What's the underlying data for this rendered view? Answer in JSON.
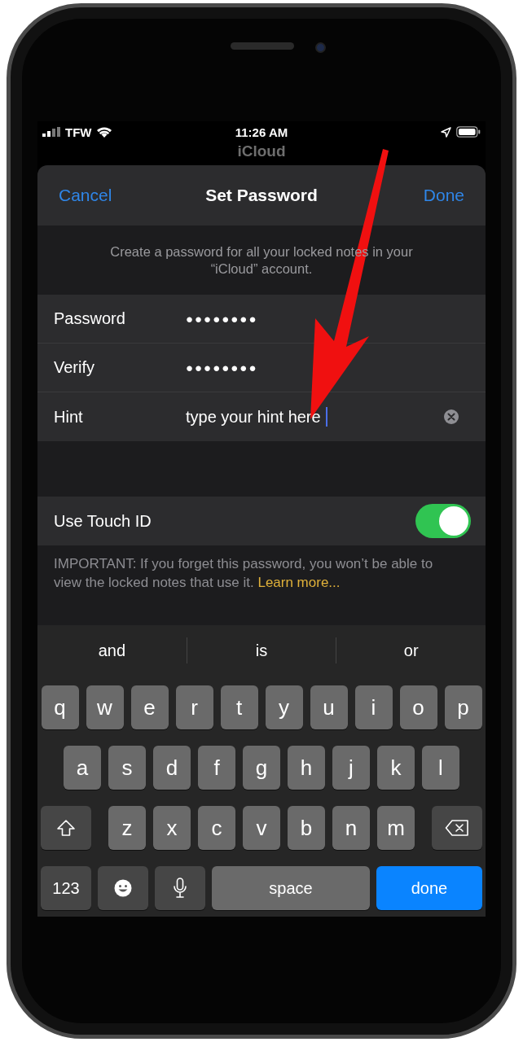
{
  "status_bar": {
    "carrier": "TFW",
    "time": "11:26 AM"
  },
  "nav": {
    "title": "iCloud"
  },
  "sheet": {
    "cancel": "Cancel",
    "title": "Set Password",
    "done": "Done",
    "description": "Create a password for all your locked notes in your “iCloud” account."
  },
  "fields": [
    {
      "label": "Password",
      "value": "●●●●●●●●",
      "kind": "secure",
      "focused": false
    },
    {
      "label": "Verify",
      "value": "●●●●●●●●",
      "kind": "secure",
      "focused": false
    },
    {
      "label": "Hint",
      "value": "type your hint here",
      "kind": "text",
      "focused": true
    }
  ],
  "touch_id": {
    "label": "Use Touch ID",
    "on": true
  },
  "footer": {
    "text": "IMPORTANT: If you forget this password, you won’t be able to view the locked notes that use it.",
    "link": "Learn more..."
  },
  "suggestions": [
    "and",
    "is",
    "or"
  ],
  "keyboard": {
    "rows": [
      [
        "q",
        "w",
        "e",
        "r",
        "t",
        "y",
        "u",
        "i",
        "o",
        "p"
      ],
      [
        "a",
        "s",
        "d",
        "f",
        "g",
        "h",
        "j",
        "k",
        "l"
      ],
      [
        "z",
        "x",
        "c",
        "v",
        "b",
        "n",
        "m"
      ]
    ],
    "numbers_key": "123",
    "space_key": "space",
    "return_key": "done"
  }
}
